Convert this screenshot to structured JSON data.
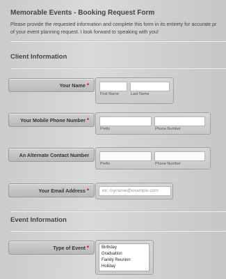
{
  "form": {
    "title": "Memorable Events - Booking Request Form",
    "intro_line1": "Please provide the requested information and complete this form in its entirety for accurate pr",
    "intro_line2": "of your event planning request. I look forward to speaking with you!"
  },
  "sections": {
    "client": "Client Information",
    "event": "Event Information"
  },
  "fields": {
    "name": {
      "label": "Your Name",
      "first_sub": "First Name",
      "last_sub": "Last Name",
      "first_value": "",
      "last_value": ""
    },
    "mobile": {
      "label": "Your Mobile Phone Number",
      "prefix_sub": "Prefix",
      "phone_sub": "Phone Number",
      "separator": "-"
    },
    "alternate": {
      "label": "An Alternate Contact Number",
      "prefix_sub": "Prefix",
      "phone_sub": "Phone Number",
      "separator": "-"
    },
    "email": {
      "label": "Your Email Address",
      "placeholder": "ex: myname@example.com"
    },
    "event_type": {
      "label": "Type of Event",
      "options": [
        "Birthday",
        "Graduation",
        "Family Reunion",
        "Holiday"
      ]
    }
  },
  "required_marker": "*",
  "colors": {
    "required": "#d01010",
    "label_bg": "#c4c4c4"
  }
}
